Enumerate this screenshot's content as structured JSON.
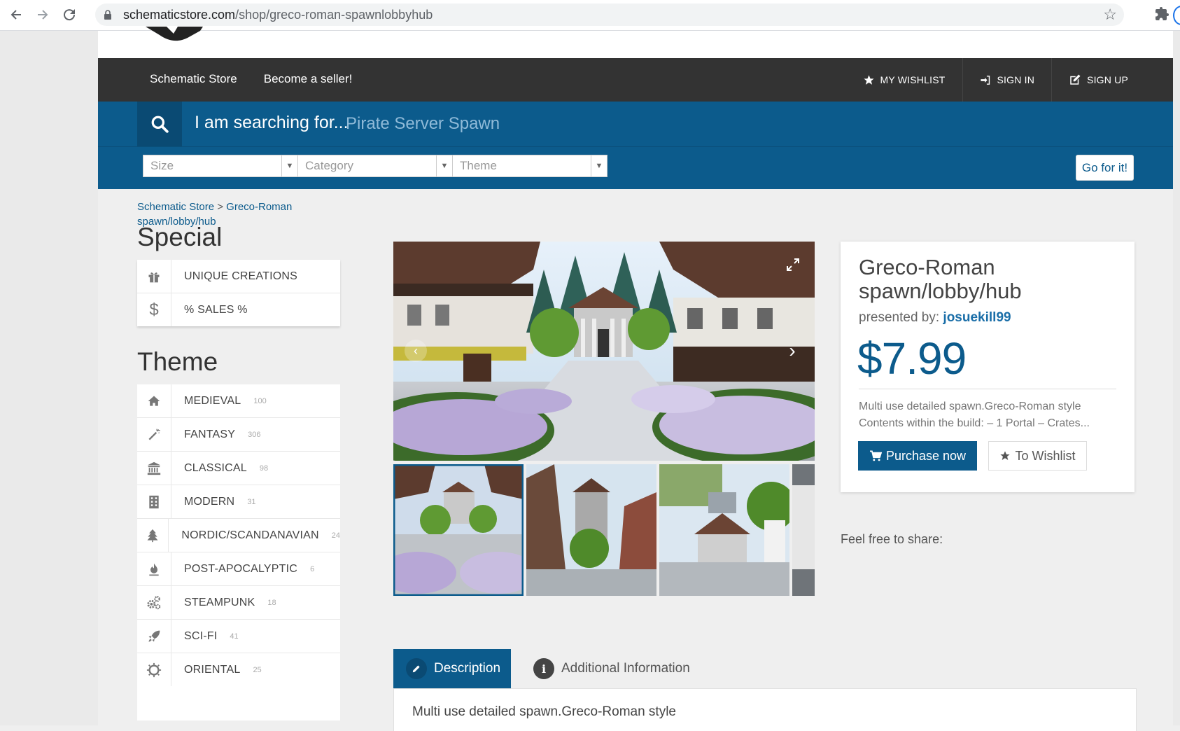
{
  "browser": {
    "url_domain": "schematicstore.com",
    "url_path": "/shop/greco-roman-spawnlobbyhub"
  },
  "topnav": {
    "left": [
      "Schematic Store",
      "Become a seller!"
    ],
    "wishlist": "MY WISHLIST",
    "signin": "SIGN IN",
    "signup": "SIGN UP"
  },
  "search": {
    "lead": "I am searching for...",
    "placeholder": "Pirate Server Spawn"
  },
  "filters": {
    "size": "Size",
    "category": "Category",
    "theme": "Theme",
    "go": "Go for it!"
  },
  "breadcrumb": {
    "home": "Schematic Store",
    "separator": ">",
    "current": "Greco-Roman spawn/lobby/hub"
  },
  "sidebar": {
    "special_title": "Special",
    "special_items": [
      {
        "label": "UNIQUE CREATIONS",
        "icon": "gift-icon"
      },
      {
        "label": "% SALES %",
        "icon": "dollar-icon"
      }
    ],
    "theme_title": "Theme",
    "theme_items": [
      {
        "label": "MEDIEVAL",
        "count": "100",
        "icon": "home-icon"
      },
      {
        "label": "FANTASY",
        "count": "306",
        "icon": "magic-wand-icon"
      },
      {
        "label": "CLASSICAL",
        "count": "98",
        "icon": "bank-icon"
      },
      {
        "label": "MODERN",
        "count": "31",
        "icon": "building-icon"
      },
      {
        "label": "NORDIC/SCANDANAVIAN",
        "count": "24",
        "icon": "tree-icon"
      },
      {
        "label": "POST-APOCALYPTIC",
        "count": "6",
        "icon": "fire-extinguisher-icon"
      },
      {
        "label": "STEAMPUNK",
        "count": "18",
        "icon": "gears-icon"
      },
      {
        "label": "SCI-FI",
        "count": "41",
        "icon": "rocket-icon"
      },
      {
        "label": "ORIENTAL",
        "count": "25",
        "icon": "sun-icon"
      }
    ]
  },
  "product": {
    "title": "Greco-Roman spawn/lobby/hub",
    "presented_by": "presented by:",
    "author": "josuekill99",
    "price": "$7.99",
    "description": "Multi use detailed spawn.Greco-Roman style Contents within the build: – 1 Portal – Crates...",
    "purchase": "Purchase now",
    "wishlist": "To Wishlist"
  },
  "share_label": "Feel free to share:",
  "tabs": {
    "description": "Description",
    "additional": "Additional Information",
    "panel_text": "Multi use detailed spawn.Greco-Roman style"
  },
  "colors": {
    "brand_blue": "#0c5b8c",
    "nav_dark": "#333333",
    "link_blue": "#1a6ea8"
  }
}
